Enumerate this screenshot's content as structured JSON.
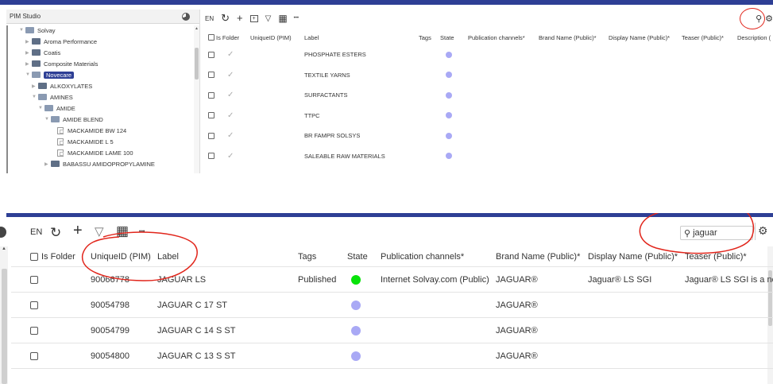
{
  "top": {
    "app_title": "PIM Studio",
    "tree": [
      {
        "label": "Solvay",
        "level": 0,
        "expanded": true,
        "type": "folder"
      },
      {
        "label": "Aroma Performance",
        "level": 1,
        "type": "folder"
      },
      {
        "label": "Coatis",
        "level": 1,
        "type": "folder"
      },
      {
        "label": "Composite Materials",
        "level": 1,
        "type": "folder"
      },
      {
        "label": "Novecare",
        "level": 1,
        "expanded": true,
        "selected": true,
        "type": "folder"
      },
      {
        "label": "ALKOXYLATES",
        "level": 2,
        "type": "folder"
      },
      {
        "label": "AMINES",
        "level": 2,
        "expanded": true,
        "type": "folder"
      },
      {
        "label": "AMIDE",
        "level": 3,
        "expanded": true,
        "type": "folder"
      },
      {
        "label": "AMIDE BLEND",
        "level": 4,
        "expanded": true,
        "type": "folder"
      },
      {
        "label": "MACKAMIDE BW 124",
        "level": 5,
        "type": "doc"
      },
      {
        "label": "MACKAMIDE L 5",
        "level": 5,
        "type": "doc"
      },
      {
        "label": "MACKAMIDE LAME 100",
        "level": 5,
        "type": "doc"
      },
      {
        "label": "BABASSU AMIDOPROPYLAMINE",
        "level": 4,
        "type": "folder"
      }
    ],
    "toolbar": {
      "lang": "EN",
      "refresh_icon": "refresh-icon",
      "add_icon": "plus-icon",
      "add_folder_icon": "add-folder-icon",
      "filter_icon": "filter-icon",
      "grid_icon": "grid-icon",
      "more_label": "•••"
    },
    "columns": [
      "Is Folder",
      "UniqueID (PIM)",
      "Label",
      "Tags",
      "State",
      "Publication channels*",
      "Brand Name (Public)*",
      "Display Name (Public)*",
      "Teaser (Public)*",
      "Description ("
    ],
    "rows": [
      {
        "label": "PHOSPHATE ESTERS"
      },
      {
        "label": "TEXTILE YARNS"
      },
      {
        "label": "SURFACTANTS"
      },
      {
        "label": "TTPC"
      },
      {
        "label": "BR FAMPR SOLSYS"
      },
      {
        "label": "SALEABLE RAW MATERIALS"
      }
    ]
  },
  "bottom": {
    "toolbar": {
      "lang": "EN",
      "more_label": "•••",
      "search_value": "jaguar"
    },
    "columns": [
      "Is Folder",
      "UniqueID (PIM)",
      "Label",
      "Tags",
      "State",
      "Publication channels*",
      "Brand Name (Public)*",
      "Display Name (Public)*",
      "Teaser (Public)*"
    ],
    "rows": [
      {
        "id": "90066778",
        "label": "JAGUAR LS",
        "tags": "Published",
        "state": "published",
        "channel": "Internet Solvay.com (Public)",
        "brand": "JAGUAR®",
        "display": "Jaguar® LS SGI",
        "teaser": "Jaguar® LS SGI is a nc"
      },
      {
        "id": "90054798",
        "label": "JAGUAR C 17 ST",
        "tags": "",
        "state": "draft",
        "channel": "",
        "brand": "JAGUAR®",
        "display": "",
        "teaser": ""
      },
      {
        "id": "90054799",
        "label": "JAGUAR C 14 S ST",
        "tags": "",
        "state": "draft",
        "channel": "",
        "brand": "JAGUAR®",
        "display": "",
        "teaser": ""
      },
      {
        "id": "90054800",
        "label": "JAGUAR C 13 S ST",
        "tags": "",
        "state": "draft",
        "channel": "",
        "brand": "JAGUAR®",
        "display": "",
        "teaser": ""
      }
    ]
  },
  "colors": {
    "brand_blue": "#2e3f95",
    "state_draft": "#a9a9f5",
    "state_published": "#08e30a",
    "annotation_red": "#e1251b"
  }
}
